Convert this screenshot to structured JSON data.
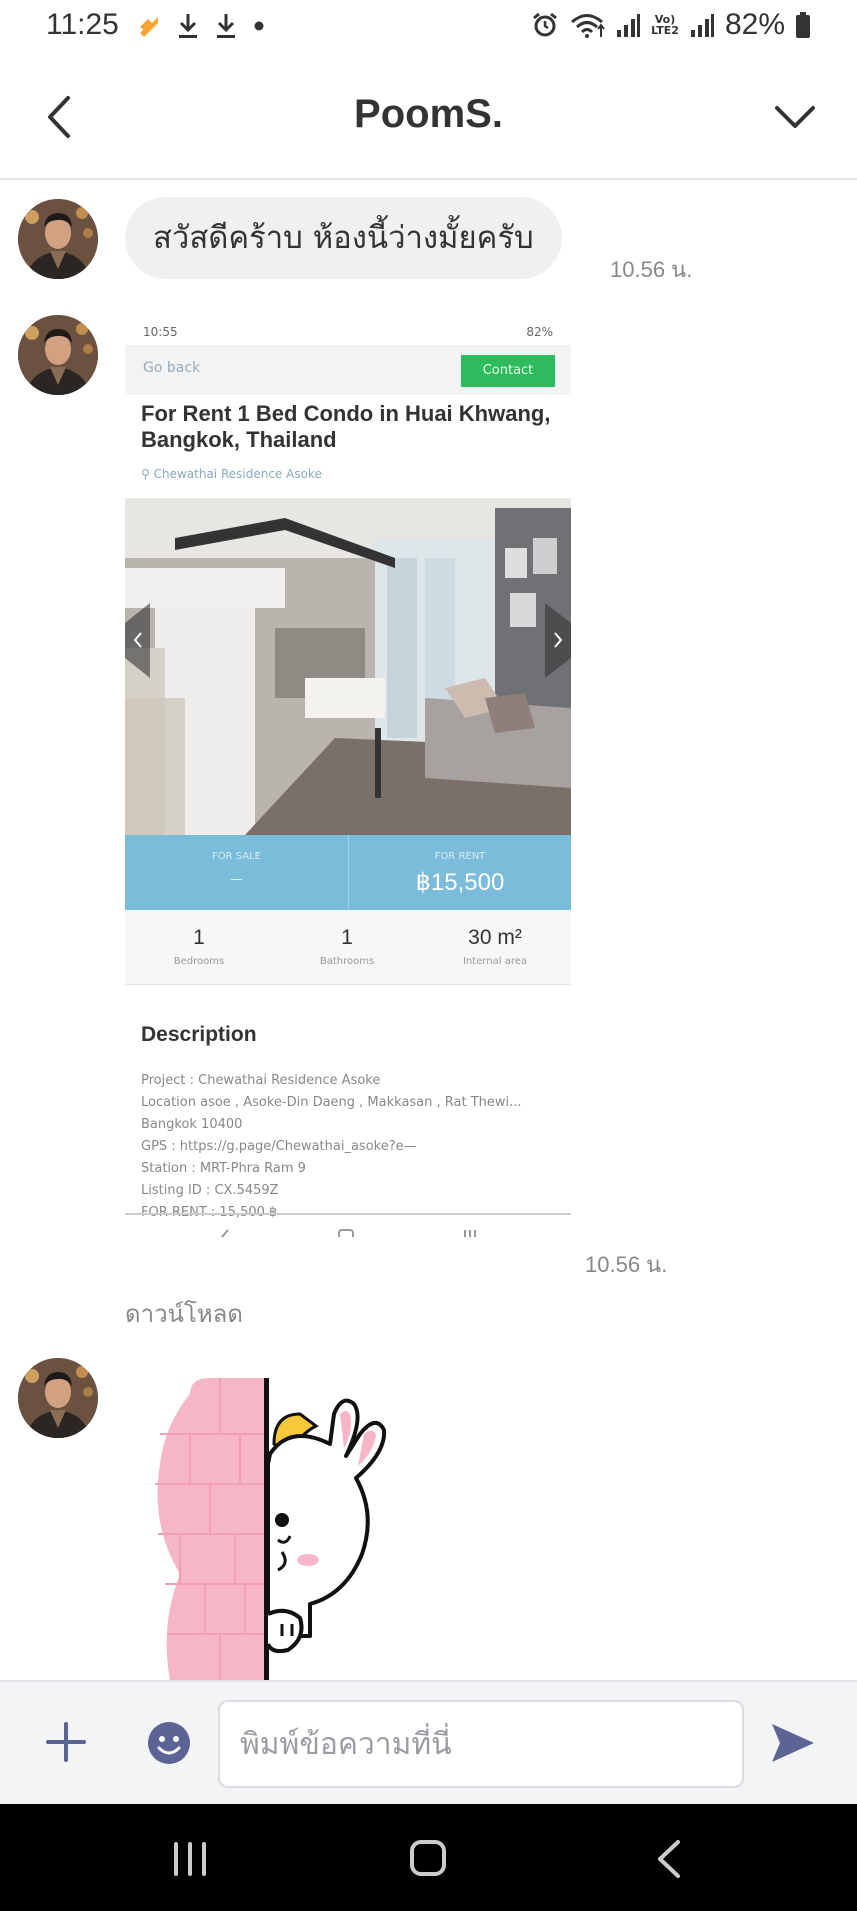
{
  "status_bar": {
    "time": "11:25",
    "battery_percent": "82%",
    "sim_label_top": "Vo)",
    "sim_label_bottom": "LTE2",
    "icons": [
      "app-notification-icon",
      "download-icon",
      "download-icon",
      "dot-icon",
      "alarm-icon",
      "wifi-icon",
      "signal-icon",
      "signal-icon",
      "battery-icon"
    ]
  },
  "header": {
    "title": "PoomS.",
    "back_icon": "chevron-left-icon",
    "menu_icon": "chevron-down-icon"
  },
  "messages": {
    "text_message": {
      "text": "สวัสดีคร้าบ ห้องนี้ว่างมั้ยครับ",
      "time": "10.56 น."
    },
    "image_message": {
      "time": "10.56 น.",
      "download_label": "ดาวน์โหลด",
      "screenshot": {
        "status_time": "10:55",
        "status_battery": "82%",
        "back_label": "Go back",
        "contact_label": "Contact",
        "title": "For Rent 1 Bed Condo in Huai Khwang, Bangkok, Thailand",
        "location": "Chewathai Residence Asoke",
        "sale_label": "FOR SALE",
        "sale_value": "—",
        "rent_label": "FOR RENT",
        "rent_value": "฿15,500",
        "stats": [
          {
            "value": "1",
            "label": "Bedrooms"
          },
          {
            "value": "1",
            "label": "Bathrooms"
          },
          {
            "value": "30 m²",
            "label": "Internal area"
          }
        ],
        "description_title": "Description",
        "description_lines": [
          "Project : Chewathai Residence Asoke",
          "Location asoe , Asoke-Din Daeng , Makkasan , Rat Thewi...",
          "Bangkok 10400",
          "GPS : https://g.page/Chewathai_asoke?e—",
          "Station : MRT-Phra Ram 9",
          "Listing ID : CX.5459Z",
          "FOR RENT : 15,500 ฿"
        ]
      }
    },
    "sticker_message": {
      "sticker": "bunny-peeking-sticker"
    }
  },
  "input_bar": {
    "placeholder": "พิมพ์ข้อความที่นี่",
    "value": "",
    "plus_icon": "plus-icon",
    "emoji_icon": "emoji-icon",
    "send_icon": "send-icon"
  },
  "system_nav": {
    "recents_icon": "recents-icon",
    "home_icon": "home-icon",
    "back_icon": "back-icon"
  },
  "colors": {
    "accent_purple": "#5b6494",
    "bubble_bg": "#eef0f2",
    "price_bar": "#7bbcdb",
    "contact_green": "#2dbb5e"
  }
}
